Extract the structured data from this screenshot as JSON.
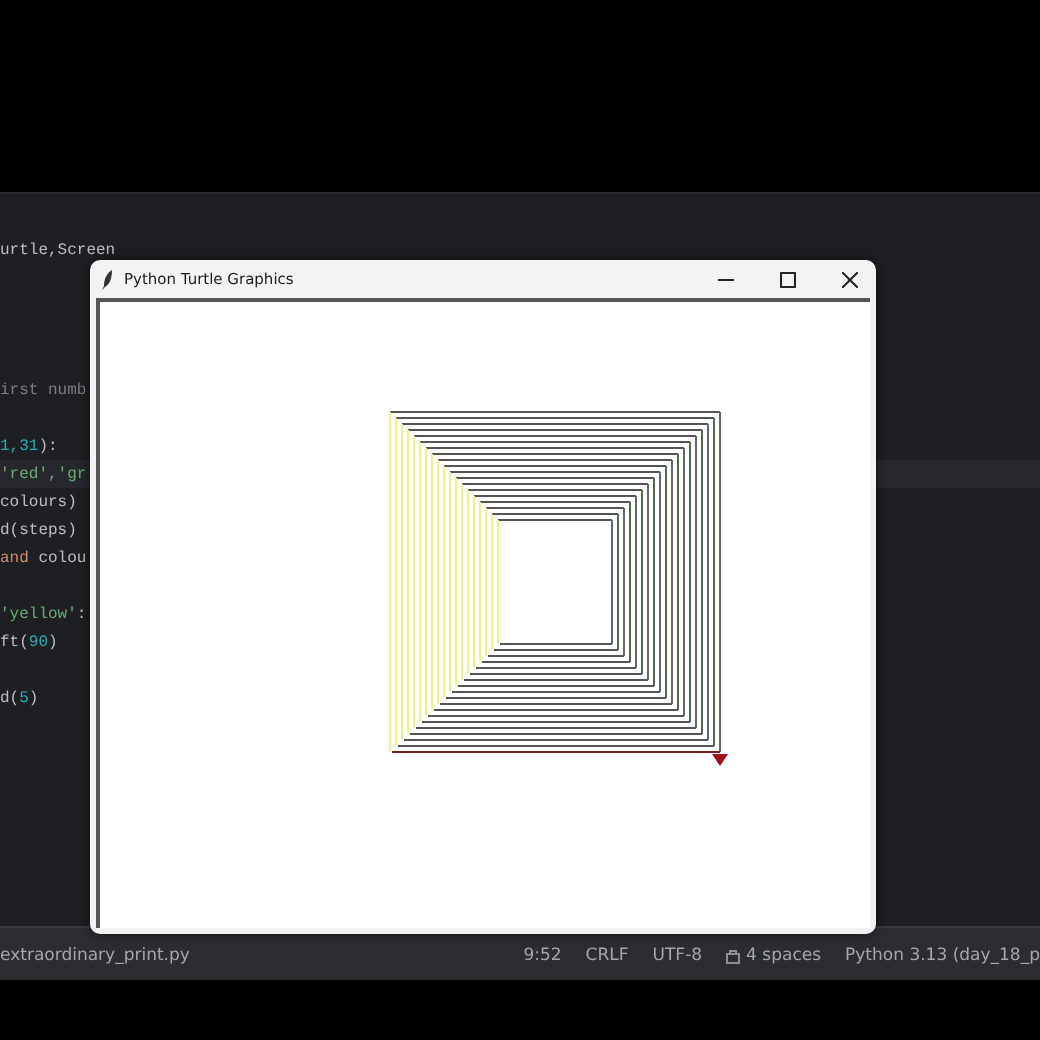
{
  "editor": {
    "blocks": [
      [
        {
          "tokens": [
            {
              "text": "urtle,Screen",
              "kind": "plain"
            }
          ]
        }
      ],
      [
        {
          "tokens": [
            {
              "text": "irst numb",
              "kind": "comment"
            }
          ]
        }
      ],
      [
        {
          "tokens": [
            {
              "text": "1,31",
              "kind": "number"
            },
            {
              "text": "):",
              "kind": "plain"
            }
          ]
        },
        {
          "tokens": [
            {
              "text": "'red','gr",
              "kind": "string"
            }
          ],
          "selected": true
        },
        {
          "tokens": [
            {
              "text": "colours)",
              "kind": "plain"
            }
          ]
        },
        {
          "tokens": [
            {
              "text": "d(steps)",
              "kind": "plain"
            }
          ]
        },
        {
          "tokens": [
            {
              "text": "and",
              "kind": "keyword"
            },
            {
              "text": " colou",
              "kind": "plain"
            }
          ]
        }
      ],
      [
        {
          "tokens": [
            {
              "text": "'yellow'",
              "kind": "string"
            },
            {
              "text": ":",
              "kind": "plain"
            }
          ]
        },
        {
          "tokens": [
            {
              "text": "ft(",
              "kind": "plain"
            },
            {
              "text": "90",
              "kind": "number"
            },
            {
              "text": ")",
              "kind": "plain"
            }
          ]
        }
      ],
      [
        {
          "tokens": [
            {
              "text": "d(",
              "kind": "plain"
            },
            {
              "text": "5",
              "kind": "number"
            },
            {
              "text": ")",
              "kind": "plain"
            }
          ]
        }
      ]
    ]
  },
  "turtle_window": {
    "title": "Python Turtle Graphics"
  },
  "status_bar": {
    "file": "extraordinary_print.py",
    "position": "9:52",
    "line_separator": "CRLF",
    "encoding": "UTF-8",
    "indent": "4 spaces",
    "interpreter": "Python 3.13 (day_18_p"
  }
}
